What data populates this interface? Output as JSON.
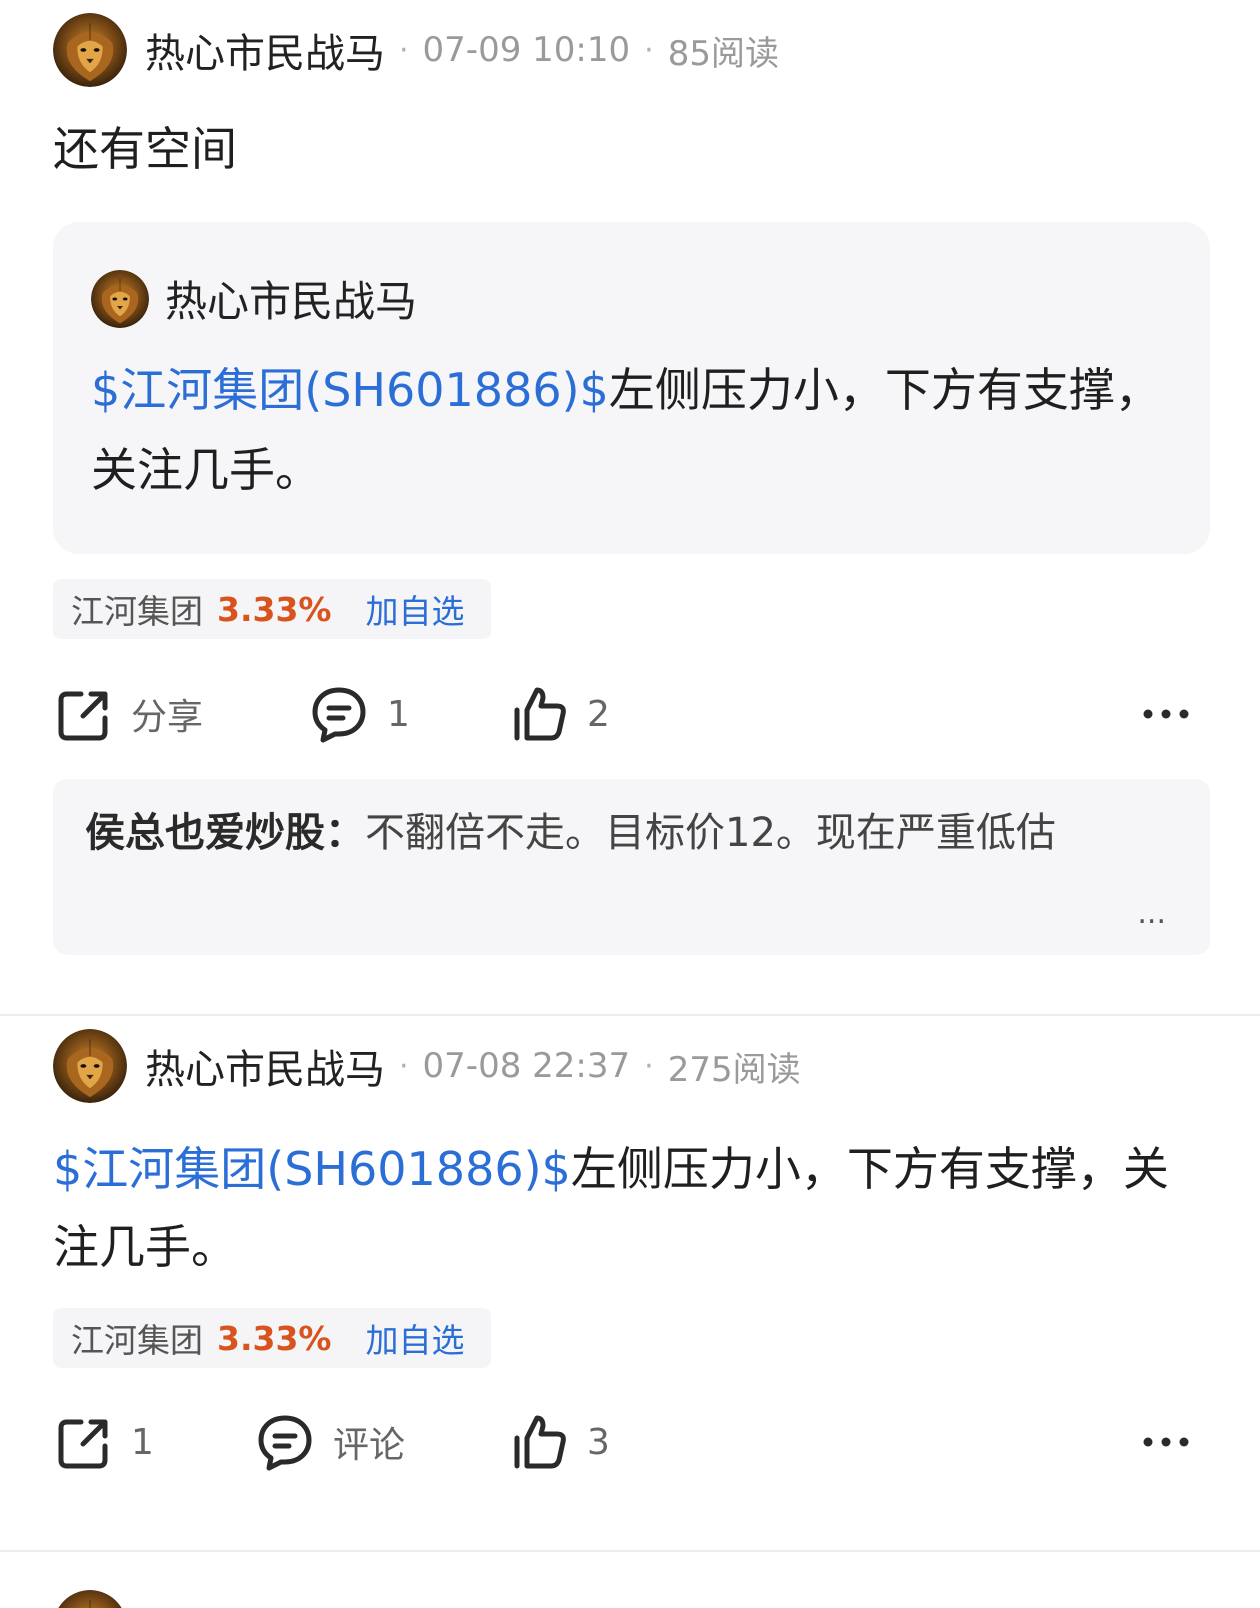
{
  "posts": [
    {
      "author": "热心市民战马",
      "time": "07-09 10:10",
      "reads": "85阅读",
      "text": "还有空间",
      "quote": {
        "author": "热心市民战马",
        "stock_link": "$江河集团(SH601886)$",
        "text": "左侧压力小，下方有支撑，关注几手。"
      },
      "stock_chip": {
        "name": "江河集团",
        "change": "3.33%",
        "add_label": "加自选"
      },
      "actions": {
        "share": "分享",
        "comment": "1",
        "like": "2"
      },
      "comment_preview": {
        "author": "侯总也爱炒股：",
        "text": "不翻倍不走。目标价12。现在严重低估",
        "ellipsis": "..."
      }
    },
    {
      "author": "热心市民战马",
      "time": "07-08 22:37",
      "reads": "275阅读",
      "stock_link": "$江河集团(SH601886)$",
      "text": "左侧压力小，下方有支撑，关注几手。",
      "stock_chip": {
        "name": "江河集团",
        "change": "3.33%",
        "add_label": "加自选"
      },
      "actions": {
        "share": "1",
        "comment": "评论",
        "like": "3"
      }
    }
  ],
  "separator_dot": "·",
  "colors": {
    "link": "#2b6fd6",
    "rise": "#d9531e",
    "card_bg": "#f6f6f8"
  },
  "icons": [
    "lion-avatar",
    "share-icon",
    "comment-icon",
    "like-icon",
    "more-icon"
  ]
}
